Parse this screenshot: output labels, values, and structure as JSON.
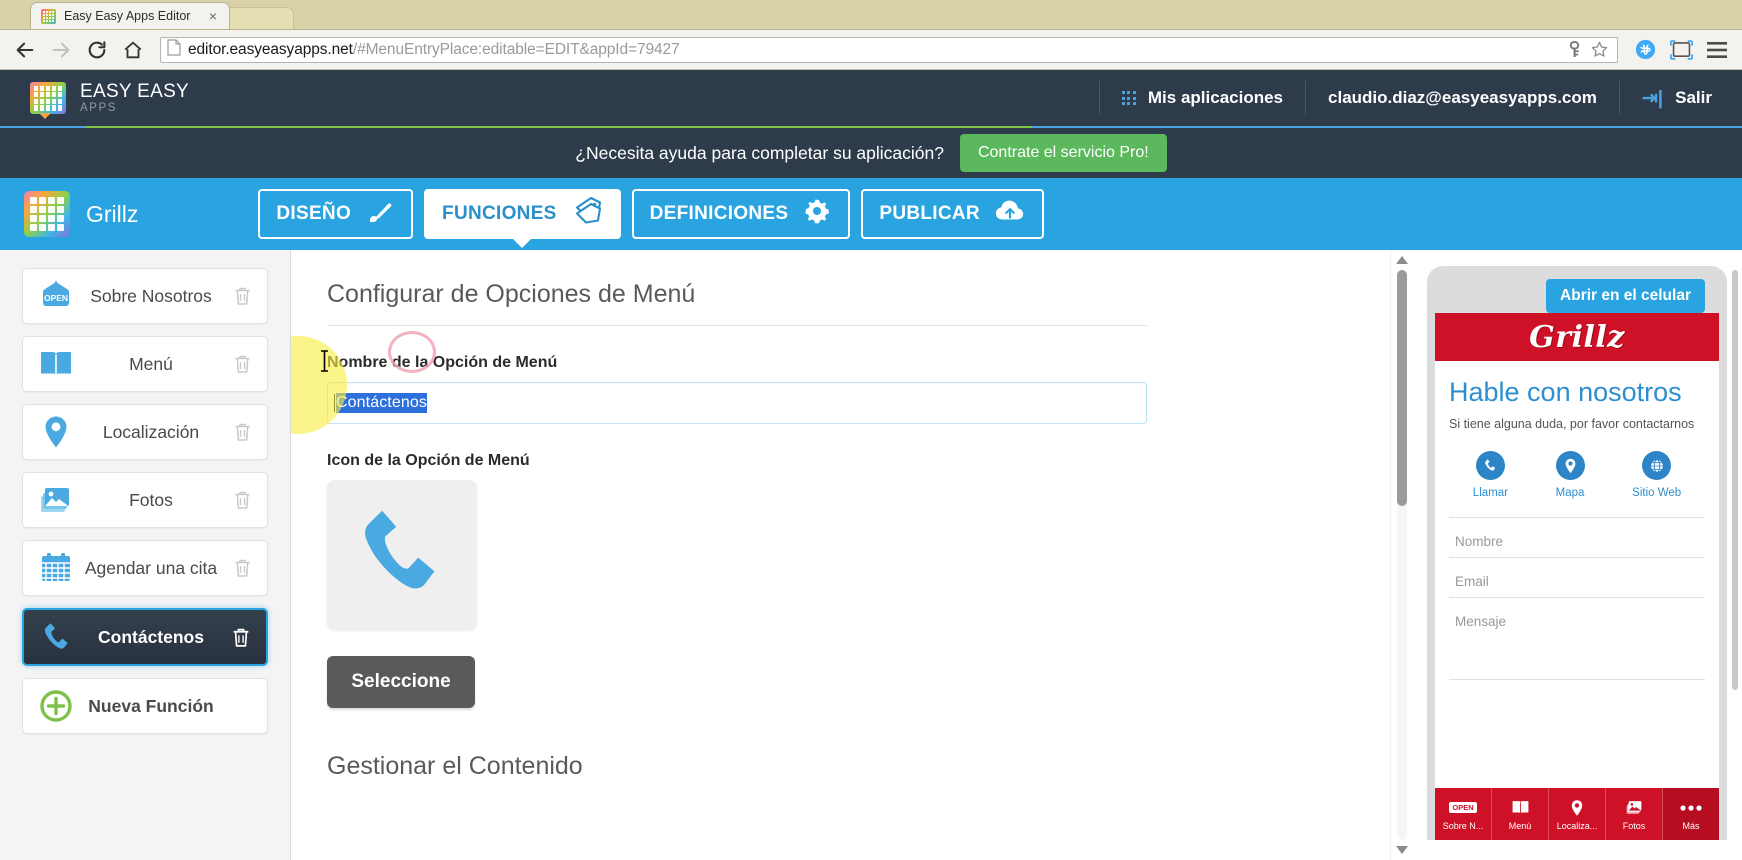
{
  "browser": {
    "tab_title": "Easy Easy Apps Editor",
    "tab_close": "×",
    "url_domain": "editor.easyeasyapps.net",
    "url_path": "/#MenuEntryPlace:editable=EDIT&appId=79427",
    "icons": {
      "back": "back-arrow-icon",
      "forward": "forward-arrow-icon",
      "reload": "reload-icon",
      "home": "home-icon",
      "page": "page-icon",
      "key": "key-icon",
      "star": "star-icon",
      "extension": "extension-icon",
      "cast": "cast-icon",
      "menu": "hamburger-menu-icon"
    }
  },
  "appbar": {
    "brand_name": "EASY EASY",
    "brand_sub": "APPS",
    "my_apps": "Mis aplicaciones",
    "account_email": "claudio.diaz@easyeasyapps.com",
    "logout": "Salir"
  },
  "helpbar": {
    "text": "¿Necesita ayuda para completar su aplicación?",
    "button": "Contrate el servicio Pro!",
    "button_color": "#5cb85c"
  },
  "apptabs": {
    "app_name": "Grillz",
    "accent_color": "#29a4e0",
    "items": [
      {
        "label": "DISEÑO",
        "icon": "paintbrush-icon",
        "active": false
      },
      {
        "label": "FUNCIONES",
        "icon": "tags-icon",
        "active": true
      },
      {
        "label": "DEFINICIONES",
        "icon": "gear-icon",
        "active": false
      },
      {
        "label": "PUBLICAR",
        "icon": "cloud-upload-icon",
        "active": false
      }
    ]
  },
  "sidebar": {
    "items": [
      {
        "label": "Sobre Nosotros",
        "icon": "open-sign-icon",
        "selected": false
      },
      {
        "label": "Menú",
        "icon": "book-icon",
        "selected": false
      },
      {
        "label": "Localización",
        "icon": "map-pin-icon",
        "selected": false
      },
      {
        "label": "Fotos",
        "icon": "photos-icon",
        "selected": false
      },
      {
        "label": "Agendar una cita",
        "icon": "calendar-icon",
        "selected": false
      },
      {
        "label": "Contáctenos",
        "icon": "phone-icon",
        "selected": true
      }
    ],
    "new_function": {
      "label": "Nueva Función",
      "icon": "plus-circle-icon"
    },
    "delete_icon": "trash-icon"
  },
  "main": {
    "section_title": "Configurar de Opciones de Menú",
    "name_label": "Nombre de la Opción de Menú",
    "name_value": "Contáctenos",
    "icon_label": "Icon de la Opción de Menú",
    "icon_preview": "phone-icon",
    "select_button": "Seleccione",
    "content_title": "Gestionar el Contenido"
  },
  "preview": {
    "open_button": "Abrir en el celular",
    "app_logo_text": "Grillz",
    "header_color": "#ce1126",
    "screen_title": "Hable con nosotros",
    "screen_subtitle": "Si tiene alguna duda, por favor contactarnos",
    "actions": [
      {
        "label": "Llamar",
        "icon": "phone-icon"
      },
      {
        "label": "Mapa",
        "icon": "map-pin-icon"
      },
      {
        "label": "Sitio Web",
        "icon": "globe-icon"
      }
    ],
    "fields": [
      {
        "placeholder": "Nombre"
      },
      {
        "placeholder": "Email"
      },
      {
        "placeholder": "Mensaje"
      }
    ],
    "tabbar": [
      {
        "label": "Sobre N...",
        "icon": "open-sign-icon"
      },
      {
        "label": "Menú",
        "icon": "book-icon"
      },
      {
        "label": "Localiza...",
        "icon": "map-pin-icon"
      },
      {
        "label": "Fotos",
        "icon": "photos-icon"
      },
      {
        "label": "Más",
        "icon": "ellipsis-icon"
      }
    ]
  }
}
